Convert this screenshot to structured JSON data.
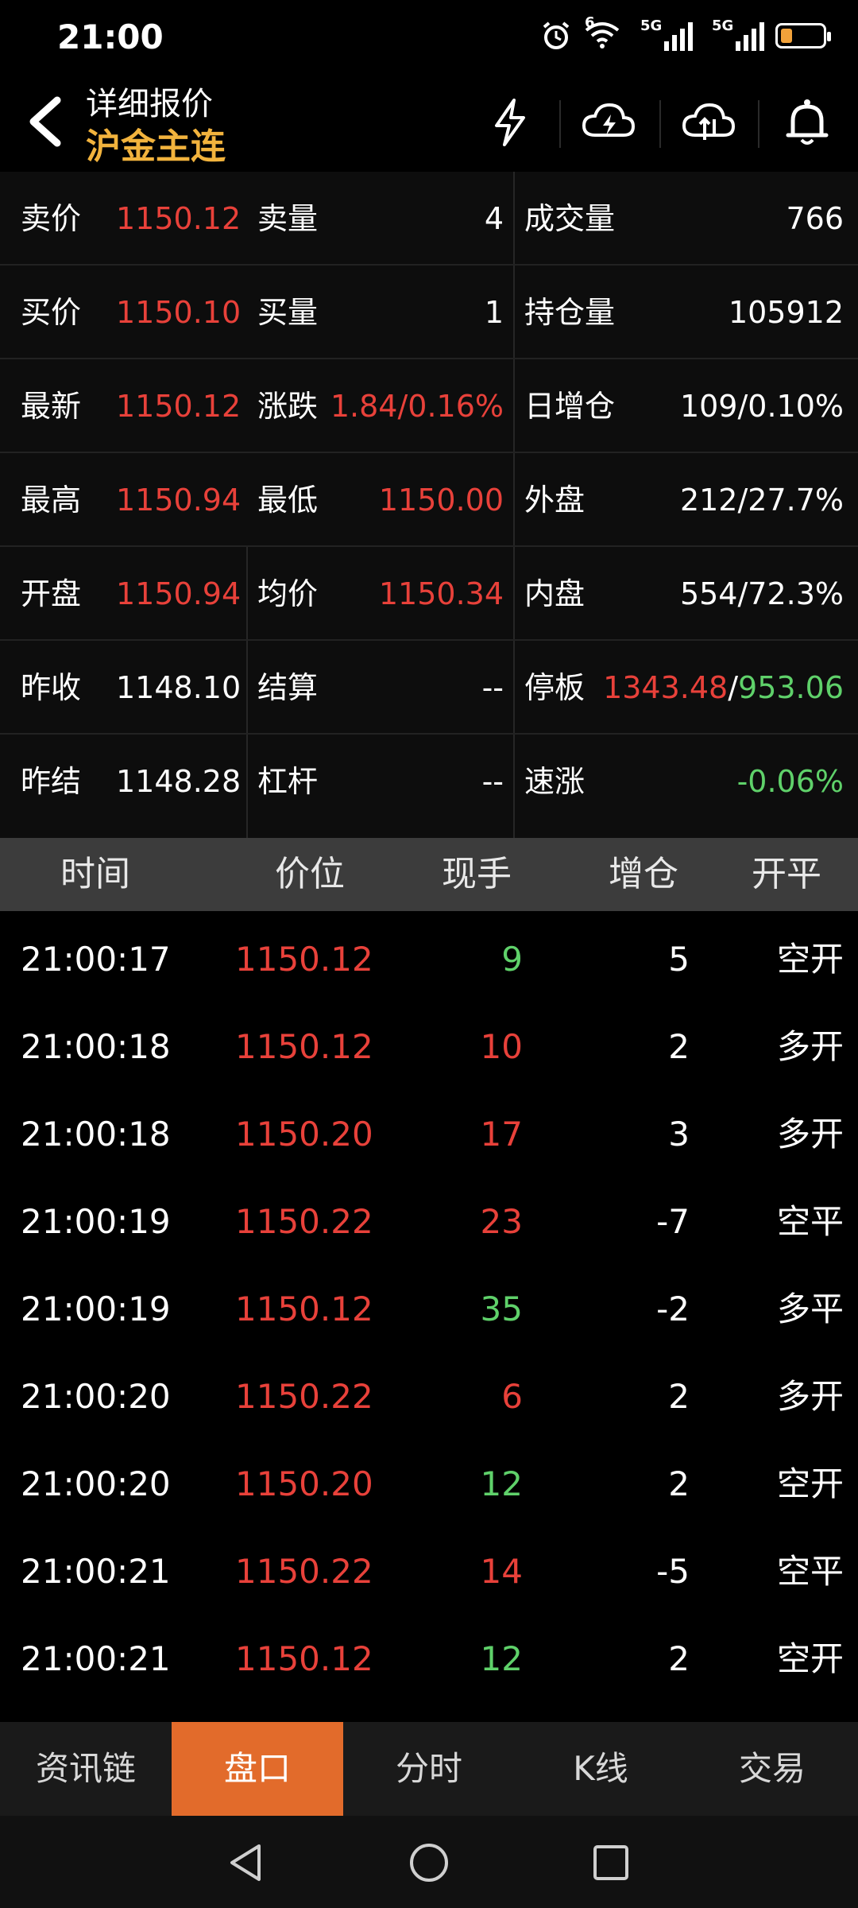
{
  "status_bar": {
    "time": "21:00",
    "wifi_tag": "6",
    "sig1_tag": "5G",
    "sig2_tag": "5G",
    "icons": [
      "alarm-icon",
      "wifi-icon",
      "signal-icon",
      "signal-icon",
      "battery-icon"
    ]
  },
  "header": {
    "title": "详细报价",
    "subtitle": "沪金主连",
    "icons": [
      "lightning-icon",
      "cloud-lightning-icon",
      "cloud-upload-icon",
      "bell-icon"
    ]
  },
  "quote": {
    "rows": [
      {
        "l1": "卖价",
        "v1": "1150.12",
        "l2": "卖量",
        "v2": "4",
        "l3": "成交量",
        "v3": "766"
      },
      {
        "l1": "买价",
        "v1": "1150.10",
        "l2": "买量",
        "v2": "1",
        "l3": "持仓量",
        "v3": "105912"
      },
      {
        "l1": "最新",
        "v1": "1150.12",
        "l2": "涨跌",
        "v2": "1.84/0.16%",
        "l3": "日增仓",
        "v3": "109/0.10%"
      },
      {
        "l1": "最高",
        "v1": "1150.94",
        "l2": "最低",
        "v2": "1150.00",
        "l3": "外盘",
        "v3": "212/27.7%"
      },
      {
        "l1": "开盘",
        "v1": "1150.94",
        "l2": "均价",
        "v2": "1150.34",
        "l3": "内盘",
        "v3": "554/72.3%"
      },
      {
        "l1": "昨收",
        "v1": "1148.10",
        "l2": "结算",
        "v2": "--",
        "l3": "停板",
        "v3a": "1343.48",
        "v3sep": "/",
        "v3b": "953.06"
      },
      {
        "l1": "昨结",
        "v1": "1148.28",
        "l2": "杠杆",
        "v2": "--",
        "l3": "速涨",
        "v3": "-0.06%"
      }
    ]
  },
  "trades": {
    "headers": [
      "时间",
      "价位",
      "现手",
      "增仓",
      "开平"
    ],
    "rows": [
      {
        "time": "21:00:17",
        "price": "1150.12",
        "vol": "9",
        "oi": "5",
        "type": "空开"
      },
      {
        "time": "21:00:18",
        "price": "1150.12",
        "vol": "10",
        "oi": "2",
        "type": "多开"
      },
      {
        "time": "21:00:18",
        "price": "1150.20",
        "vol": "17",
        "oi": "3",
        "type": "多开"
      },
      {
        "time": "21:00:19",
        "price": "1150.22",
        "vol": "23",
        "oi": "-7",
        "type": "空平"
      },
      {
        "time": "21:00:19",
        "price": "1150.12",
        "vol": "35",
        "oi": "-2",
        "type": "多平"
      },
      {
        "time": "21:00:20",
        "price": "1150.22",
        "vol": "6",
        "oi": "2",
        "type": "多开"
      },
      {
        "time": "21:00:20",
        "price": "1150.20",
        "vol": "12",
        "oi": "2",
        "type": "空开"
      },
      {
        "time": "21:00:21",
        "price": "1150.22",
        "vol": "14",
        "oi": "-5",
        "type": "空平"
      },
      {
        "time": "21:00:21",
        "price": "1150.12",
        "vol": "12",
        "oi": "2",
        "type": "空开"
      }
    ]
  },
  "tabs": {
    "items": [
      {
        "label": "资讯链"
      },
      {
        "label": "盘口"
      },
      {
        "label": "分时"
      },
      {
        "label": "K线"
      },
      {
        "label": "交易"
      }
    ],
    "active": "盘口"
  },
  "colors": {
    "up": "#e8413a",
    "down": "#5fd16a",
    "accent": "#e26b2b",
    "subtitle": "#f2b33d"
  }
}
